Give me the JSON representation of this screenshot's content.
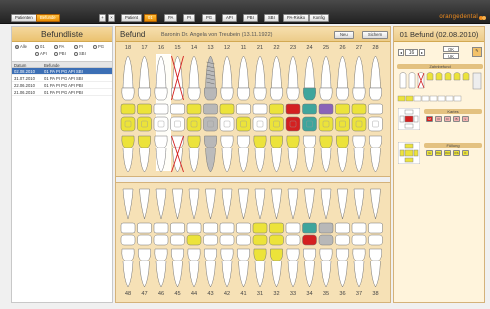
{
  "toolbar": {
    "patients": "Patienten",
    "findings": "Befunde",
    "buttons": [
      "Patient",
      "01",
      "PA",
      "PI",
      "PG",
      "API",
      "PBI",
      "SBI",
      "PA-Risiko",
      "Konfig"
    ],
    "brand": "orangedental"
  },
  "left": {
    "title": "Befundliste",
    "filters": [
      "Alle",
      "01",
      "PA",
      "PI",
      "PG",
      "API",
      "PBI",
      "SBI"
    ],
    "columns": [
      "Datum",
      "Befunde"
    ],
    "rows": [
      {
        "date": "02.08.2010",
        "findings": "01 PA PI PG API SBI",
        "selected": true
      },
      {
        "date": "31.07.2010",
        "findings": "01 PA PI PG API SBI",
        "selected": false
      },
      {
        "date": "22.06.2010",
        "findings": "01 PA PI PG API PBI",
        "selected": false
      },
      {
        "date": "21.06.2010",
        "findings": "01 PA PI PG API PBI",
        "selected": false
      }
    ]
  },
  "center": {
    "title": "Befund",
    "patient": "Baronin Dr. Angela von Treubein (13.11.1922)",
    "new_btn": "Neu",
    "save_btn": "Sichern",
    "upper_numbers": [
      "18",
      "17",
      "16",
      "15",
      "14",
      "13",
      "12",
      "11",
      "21",
      "22",
      "23",
      "24",
      "25",
      "26",
      "27",
      "28"
    ],
    "lower_numbers": [
      "48",
      "47",
      "46",
      "45",
      "44",
      "43",
      "42",
      "41",
      "31",
      "32",
      "33",
      "34",
      "35",
      "36",
      "37",
      "38"
    ]
  },
  "right": {
    "title": "01 Befund (02.08.2010)",
    "tooth_number": "16",
    "ok": "OK",
    "uk": "UK",
    "section_zahn": "Zahnbefund",
    "section_karies": "Karies",
    "section_fuellung": "Füllung",
    "karies_chips": [
      "M",
      "O",
      "D",
      "B",
      "L"
    ],
    "fuellung_chips": [
      "G",
      "KG",
      "KO",
      "KS",
      "K"
    ]
  },
  "colors": {
    "accent": "#f08c1e",
    "panel": "#f6e1b6",
    "filling_yellow": "#ece33a",
    "crown_gray": "#b8b8b8",
    "teal": "#3fa59c",
    "red": "#d42020",
    "purple": "#8a63b8"
  }
}
